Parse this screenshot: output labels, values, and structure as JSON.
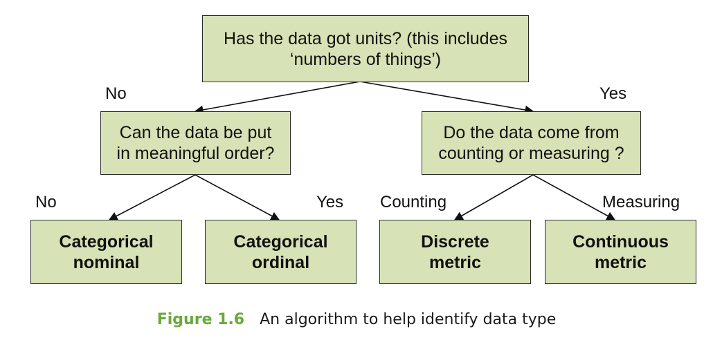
{
  "diagram": {
    "root": {
      "line1": "Has the data got units? (this includes",
      "line2": "‘numbers of things’)"
    },
    "left_question": {
      "line1": "Can the data be put",
      "line2": "in meaningful order?"
    },
    "right_question": {
      "line1": "Do the data come from",
      "line2": "counting or measuring ?"
    },
    "leaves": [
      {
        "line1": "Categorical",
        "line2": "nominal"
      },
      {
        "line1": "Categorical",
        "line2": "ordinal"
      },
      {
        "line1": "Discrete",
        "line2": "metric"
      },
      {
        "line1": "Continuous",
        "line2": "metric"
      }
    ],
    "edge_labels": {
      "root_no": "No",
      "root_yes": "Yes",
      "order_no": "No",
      "order_yes": "Yes",
      "counting": "Counting",
      "measuring": "Measuring"
    },
    "colors": {
      "box_fill": "#d7e2b6",
      "box_border": "#2b2b2b",
      "caption_number": "#6aaa3c"
    }
  },
  "caption": {
    "number": "Figure 1.6",
    "text": "An algorithm to help identify data type"
  }
}
